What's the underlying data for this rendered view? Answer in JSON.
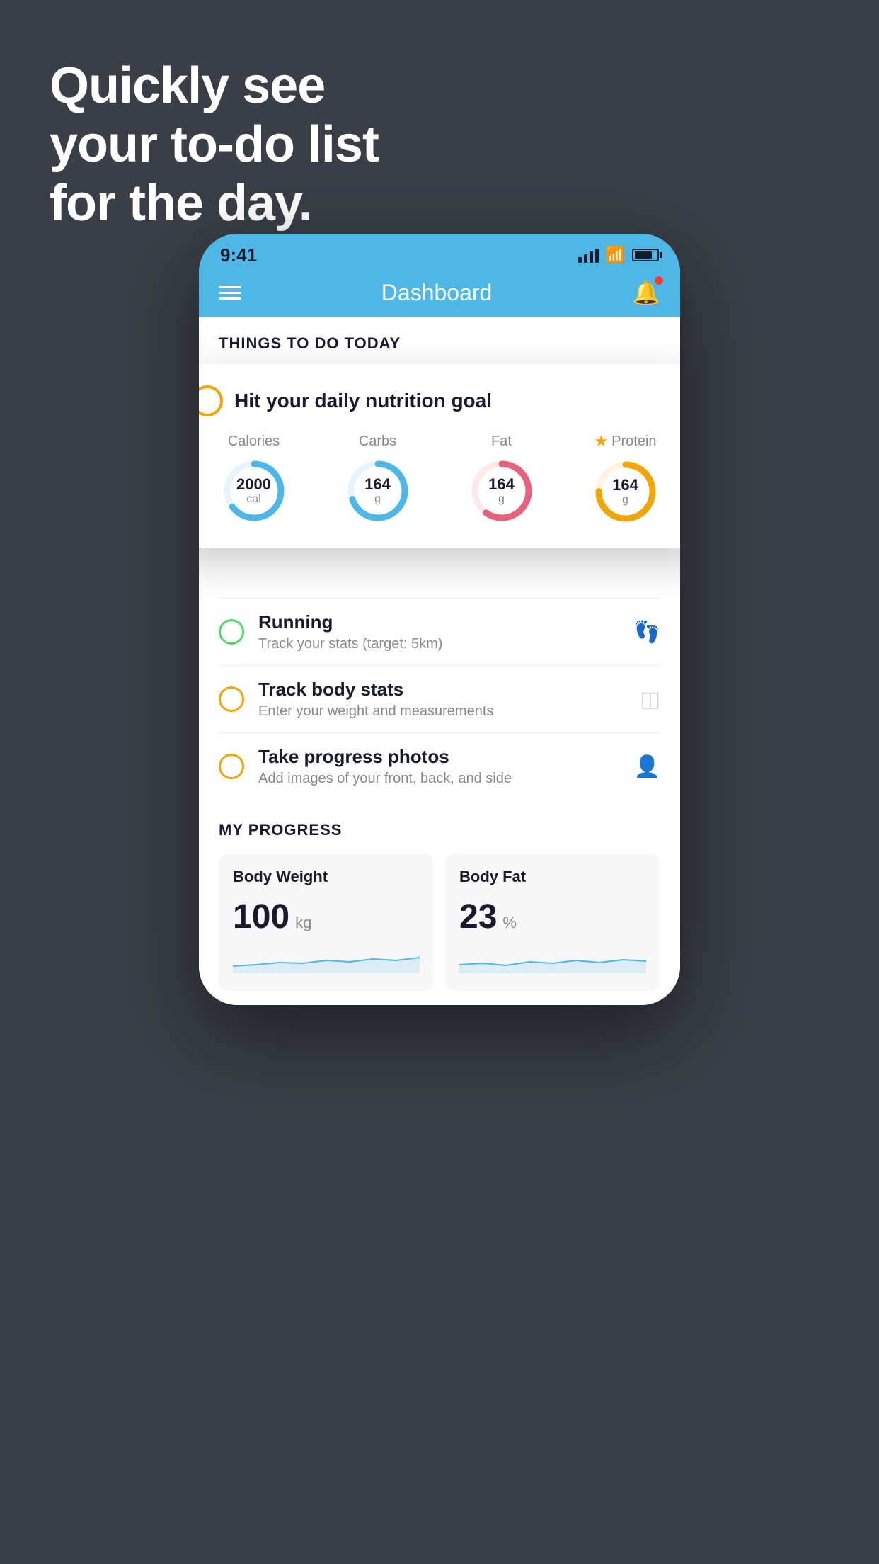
{
  "background": {
    "color": "#3a3f47"
  },
  "hero": {
    "line1": "Quickly see",
    "line2": "your to-do list",
    "line3": "for the day."
  },
  "phone": {
    "status_bar": {
      "time": "9:41"
    },
    "nav": {
      "title": "Dashboard"
    },
    "things_section": {
      "header": "THINGS TO DO TODAY"
    },
    "nutrition_card": {
      "title": "Hit your daily nutrition goal",
      "stats": [
        {
          "label": "Calories",
          "value": "2000",
          "unit": "cal",
          "color": "#4db8e8",
          "percent": 65
        },
        {
          "label": "Carbs",
          "value": "164",
          "unit": "g",
          "color": "#4db8e8",
          "percent": 70
        },
        {
          "label": "Fat",
          "value": "164",
          "unit": "g",
          "color": "#e8607a",
          "percent": 60
        },
        {
          "label": "Protein",
          "value": "164",
          "unit": "g",
          "color": "#f0a500",
          "percent": 75,
          "starred": true
        }
      ]
    },
    "todo_items": [
      {
        "title": "Running",
        "subtitle": "Track your stats (target: 5km)",
        "circle_color": "green",
        "icon": "shoe"
      },
      {
        "title": "Track body stats",
        "subtitle": "Enter your weight and measurements",
        "circle_color": "yellow",
        "icon": "scale"
      },
      {
        "title": "Take progress photos",
        "subtitle": "Add images of your front, back, and side",
        "circle_color": "yellow",
        "icon": "person"
      }
    ],
    "progress": {
      "header": "MY PROGRESS",
      "cards": [
        {
          "title": "Body Weight",
          "value": "100",
          "unit": "kg"
        },
        {
          "title": "Body Fat",
          "value": "23",
          "unit": "%"
        }
      ]
    }
  }
}
